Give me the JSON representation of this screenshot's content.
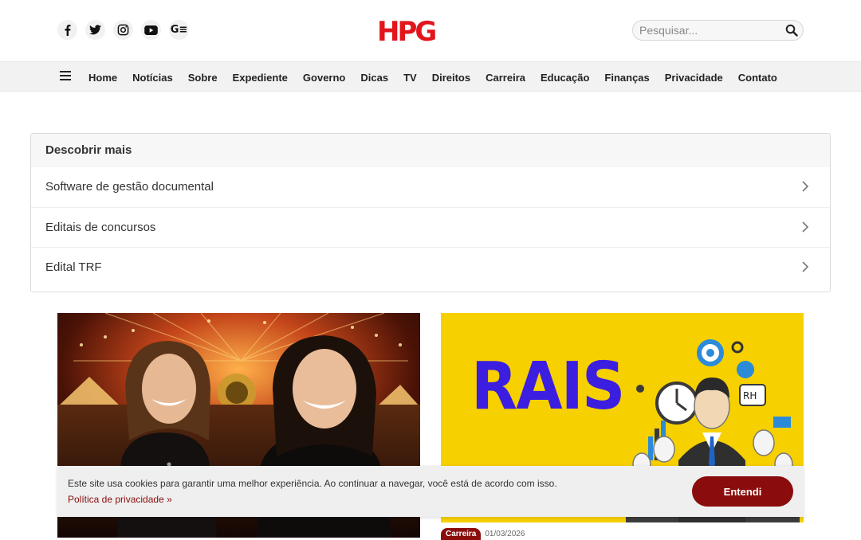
{
  "header": {
    "logo_text": "HPG",
    "social_icons": [
      "facebook-icon",
      "twitter-icon",
      "instagram-icon",
      "youtube-icon",
      "google-news-icon"
    ],
    "google_news_glyph": "G≡",
    "search": {
      "placeholder": "Pesquisar..."
    }
  },
  "nav": {
    "items": [
      "Home",
      "Notícias",
      "Sobre",
      "Expediente",
      "Governo",
      "Dicas",
      "TV",
      "Direitos",
      "Carreira",
      "Educação",
      "Finanças",
      "Privacidade",
      "Contato"
    ]
  },
  "discover": {
    "title": "Descobrir mais",
    "items": [
      "Software de gestão documental",
      "Editais de concursos",
      "Edital TRF"
    ]
  },
  "articles": {
    "right": {
      "image_text": "RAIS",
      "badge_text": "RH",
      "category": "Carreira",
      "date": "01/03/2026"
    }
  },
  "cookie": {
    "text": "Este site usa cookies para garantir uma melhor experiência. Ao continuar a navegar, você está de acordo com isso.",
    "link": "Política de privacidade »",
    "button": "Entendi"
  },
  "colors": {
    "brand_red": "#8a0c0c",
    "logo_red": "#e2151c",
    "rais_yellow": "#f7d000",
    "rais_blue": "#3b1ee0"
  }
}
